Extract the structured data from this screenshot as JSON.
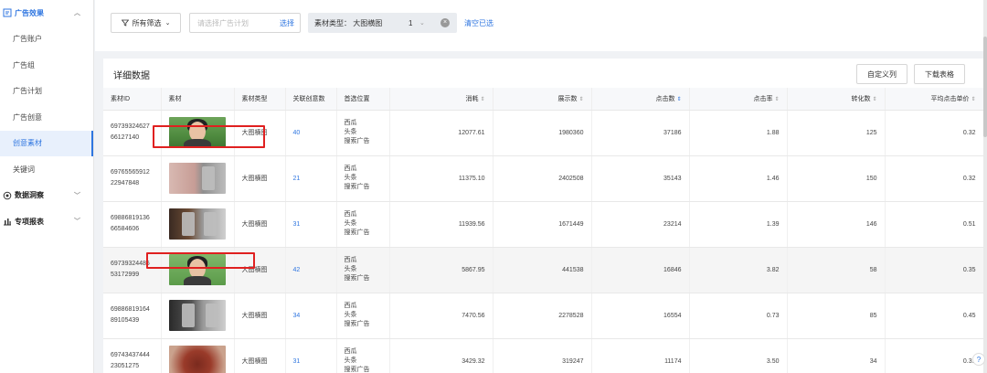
{
  "sidebar": {
    "groups": [
      {
        "label": "广告效果",
        "icon": "chart-box-icon"
      },
      {
        "label": "数据洞察",
        "icon": "insight-icon"
      },
      {
        "label": "专项报表",
        "icon": "bar-chart-icon"
      }
    ],
    "items": [
      "广告账户",
      "广告组",
      "广告计划",
      "广告创意",
      "创意素材",
      "关键词"
    ],
    "active_item": "创意素材",
    "accent_color": "#2f76e0"
  },
  "filters": {
    "all_filter_label": "所有筛选",
    "plan_placeholder": "请选择广告计划",
    "plan_select_label": "选择",
    "tag_label": "素材类型： 大图横图",
    "tag_count": "1",
    "clear_label": "清空已选"
  },
  "card": {
    "title": "详细数据",
    "custom_columns_label": "自定义列",
    "download_label": "下载表格"
  },
  "table": {
    "headers": {
      "material_id": "素材ID",
      "material": "素材",
      "material_type": "素材类型",
      "related_creatives": "关联创意数",
      "preferred_position": "首选位置",
      "cost": "消耗",
      "impressions": "展示数",
      "clicks": "点击数",
      "ctr": "点击率",
      "conversions": "转化数",
      "avg_cpc": "平均点击单价"
    },
    "rows": [
      {
        "id1": "69739324627",
        "id2": "66127140",
        "type": "大图横图",
        "related": "40",
        "pos1": "西瓜",
        "pos2": "头条",
        "pos3": "搜索广告",
        "cost": "12077.61",
        "impressions": "1980360",
        "clicks": "37186",
        "ctr": "1.88",
        "conversions": "125",
        "avg_cpc": "0.32"
      },
      {
        "id1": "69765565912",
        "id2": "22947848",
        "type": "大图横图",
        "related": "21",
        "pos1": "西瓜",
        "pos2": "头条",
        "pos3": "搜索广告",
        "cost": "11375.10",
        "impressions": "2402508",
        "clicks": "35143",
        "ctr": "1.46",
        "conversions": "150",
        "avg_cpc": "0.32"
      },
      {
        "id1": "69886819136",
        "id2": "66584606",
        "type": "大图横图",
        "related": "31",
        "pos1": "西瓜",
        "pos2": "头条",
        "pos3": "搜索广告",
        "cost": "11939.56",
        "impressions": "1671449",
        "clicks": "23214",
        "ctr": "1.39",
        "conversions": "146",
        "avg_cpc": "0.51"
      },
      {
        "id1": "69739324485",
        "id2": "53172999",
        "type": "大图横图",
        "related": "42",
        "pos1": "西瓜",
        "pos2": "头条",
        "pos3": "搜索广告",
        "cost": "5867.95",
        "impressions": "441538",
        "clicks": "16846",
        "ctr": "3.82",
        "conversions": "58",
        "avg_cpc": "0.35"
      },
      {
        "id1": "69886819164",
        "id2": "89105439",
        "type": "大图横图",
        "related": "34",
        "pos1": "西瓜",
        "pos2": "头条",
        "pos3": "搜索广告",
        "cost": "7470.56",
        "impressions": "2278528",
        "clicks": "16554",
        "ctr": "0.73",
        "conversions": "85",
        "avg_cpc": "0.45"
      },
      {
        "id1": "69743437444",
        "id2": "23051275",
        "type": "大图横图",
        "related": "31",
        "pos1": "西瓜",
        "pos2": "头条",
        "pos3": "搜索广告",
        "cost": "3429.32",
        "impressions": "319247",
        "clicks": "11174",
        "ctr": "3.50",
        "conversions": "34",
        "avg_cpc": "0.31"
      }
    ]
  }
}
